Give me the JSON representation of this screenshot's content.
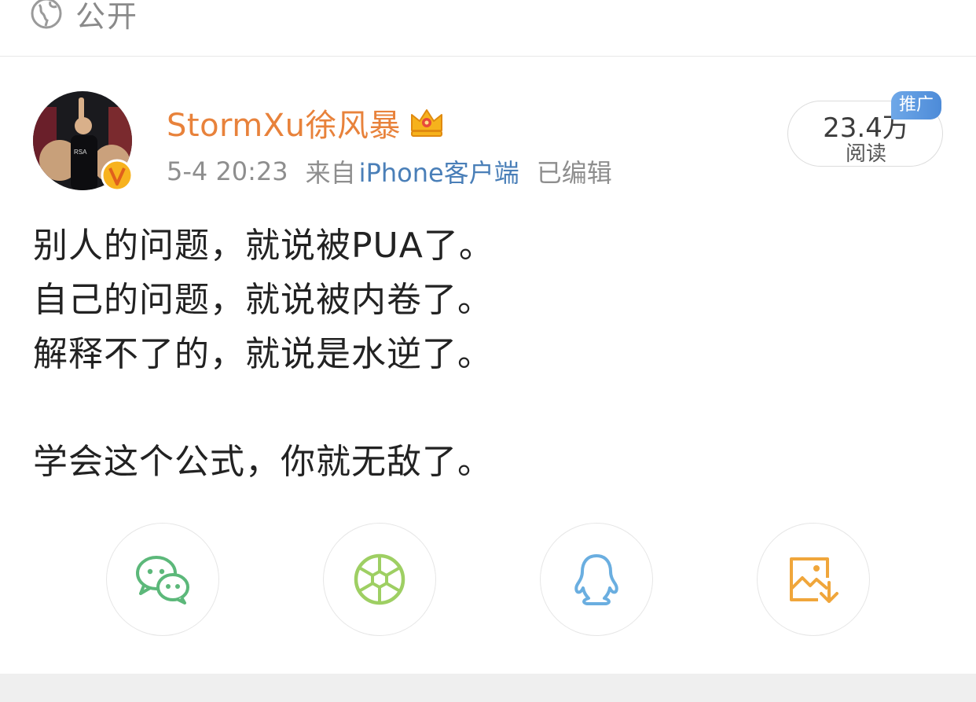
{
  "visibility": {
    "icon": "globe-icon",
    "label": "公开"
  },
  "post": {
    "author": {
      "name": "StormXu徐风暴",
      "name_color": "#e8823b",
      "avatar": "avatar",
      "badge_icon": "crown-icon",
      "verified_icon": "verified-v-icon"
    },
    "meta": {
      "time": "5-4 20:23",
      "from_label": "来自",
      "source": "iPhone客户端",
      "edited": "已编辑"
    },
    "reads": {
      "count": "23.4万",
      "label": "阅读",
      "promo_tag": "推广"
    },
    "content": {
      "line1": "别人的问题，就说被PUA了。",
      "line2": "自己的问题，就说被内卷了。",
      "line3": "解释不了的，就说是水逆了。",
      "line4": "学会这个公式，你就无敌了。"
    }
  },
  "share": [
    {
      "icon": "wechat-icon"
    },
    {
      "icon": "moments-icon"
    },
    {
      "icon": "qq-icon"
    },
    {
      "icon": "save-image-icon"
    }
  ]
}
